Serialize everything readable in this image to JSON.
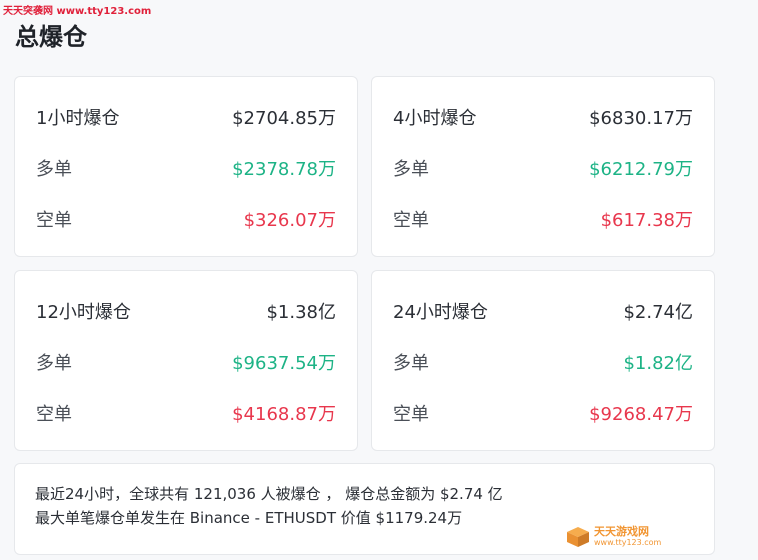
{
  "watermark_top": "天天突袭网 www.tty123.com",
  "page_title": "总爆仓",
  "cards": [
    {
      "total_label": "1小时爆仓",
      "total_value": "$2704.85万",
      "long_label": "多单",
      "long_value": "$2378.78万",
      "short_label": "空单",
      "short_value": "$326.07万"
    },
    {
      "total_label": "4小时爆仓",
      "total_value": "$6830.17万",
      "long_label": "多单",
      "long_value": "$6212.79万",
      "short_label": "空单",
      "short_value": "$617.38万"
    },
    {
      "total_label": "12小时爆仓",
      "total_value": "$1.38亿",
      "long_label": "多单",
      "long_value": "$9637.54万",
      "short_label": "空单",
      "short_value": "$4168.87万"
    },
    {
      "total_label": "24小时爆仓",
      "total_value": "$2.74亿",
      "long_label": "多单",
      "long_value": "$1.82亿",
      "short_label": "空单",
      "short_value": "$9268.47万"
    }
  ],
  "summary": {
    "line1": "最近24小时，全球共有 121,036 人被爆仓 ， 爆仓总金额为 $2.74 亿",
    "line2": "最大单笔爆仓单发生在 Binance - ETHUSDT 价值 $1179.24万"
  },
  "watermark_bottom": {
    "name": "天天游戏网",
    "url": "www.tty123.com"
  },
  "colors": {
    "long": "#1db386",
    "short": "#e8374d",
    "watermark": "#f08a1c"
  }
}
